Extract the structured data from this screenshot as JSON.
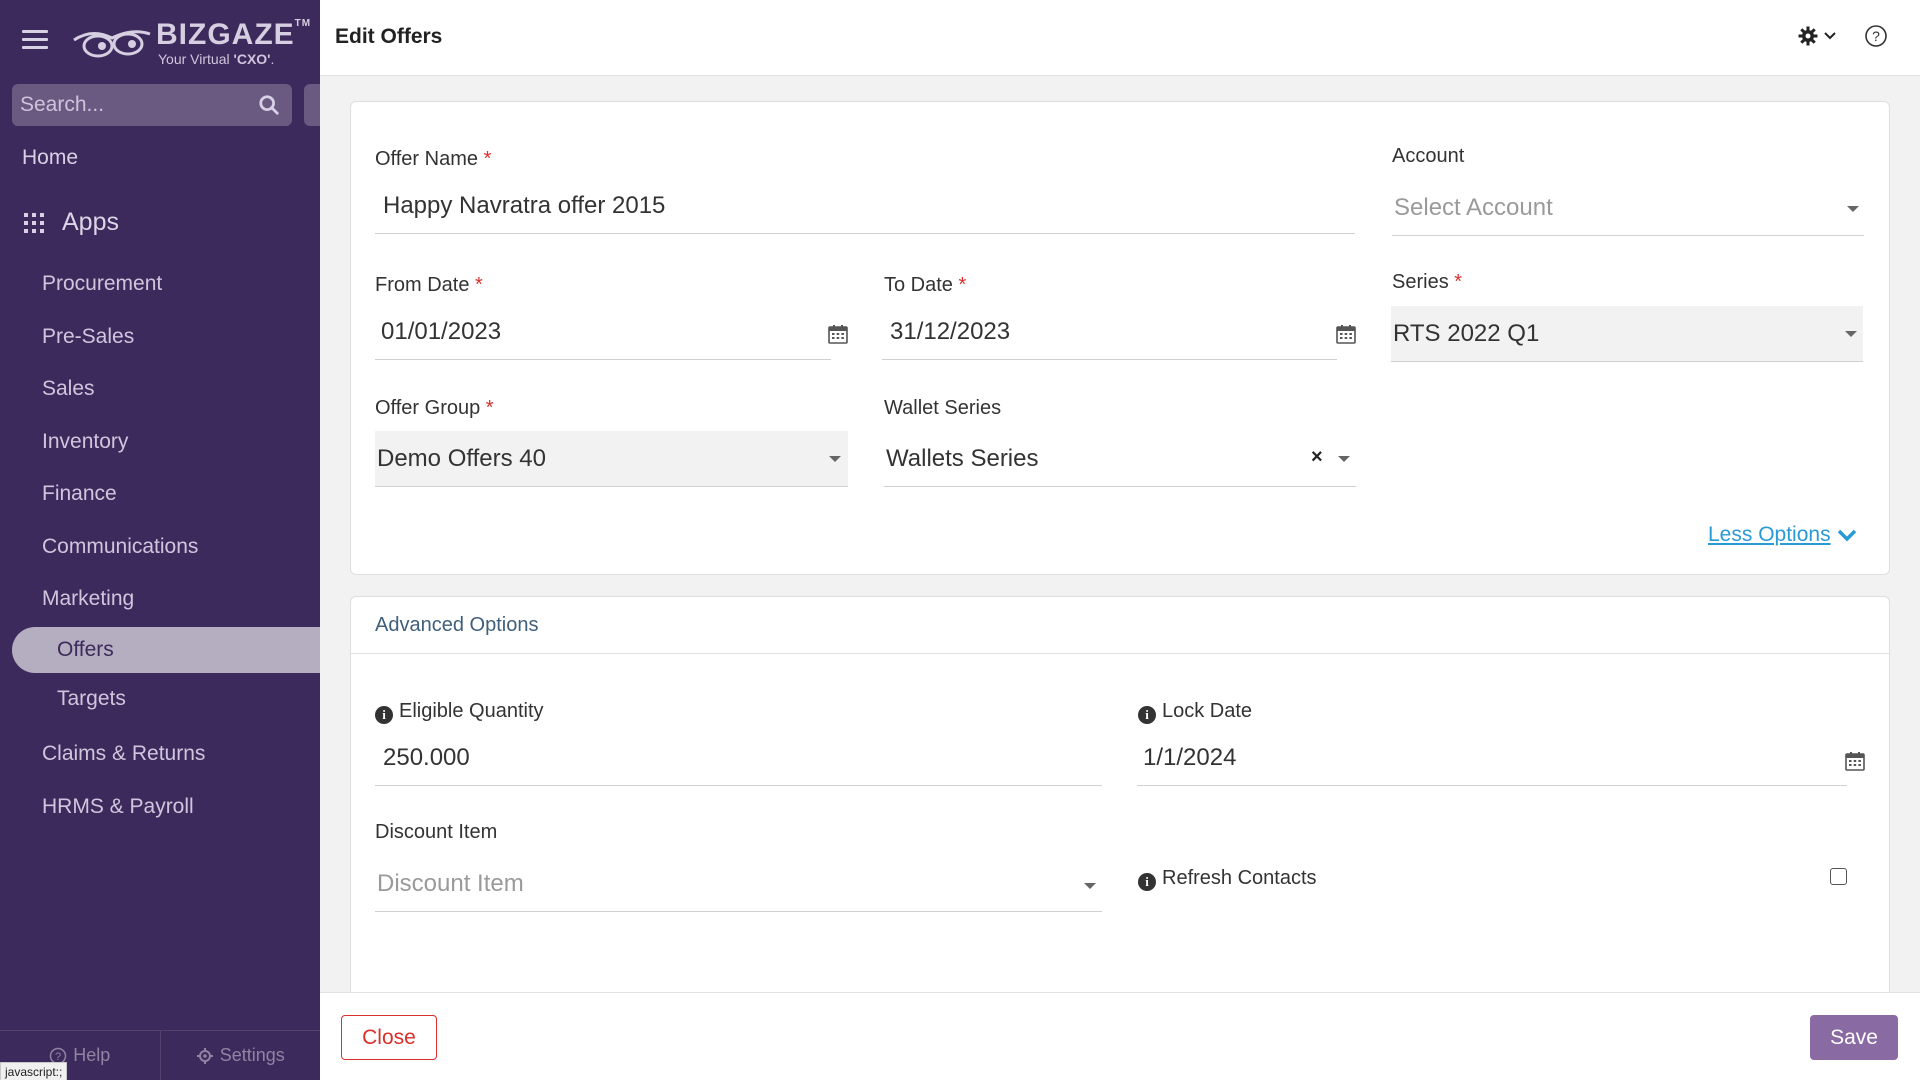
{
  "app": {
    "brand": "BIZGAZE",
    "brand_tm": "TM",
    "tagline_pre": "Your Virtual ",
    "tagline_bold": "'CXO'",
    "tagline_post": "."
  },
  "sidebar": {
    "search_placeholder": "Search...",
    "home": "Home",
    "apps": "Apps",
    "items": [
      "Procurement",
      "Pre-Sales",
      "Sales",
      "Inventory",
      "Finance",
      "Communications",
      "Marketing"
    ],
    "marketing_sub": [
      "Offers",
      "Targets"
    ],
    "items_after": [
      "Claims & Returns",
      "HRMS & Payroll"
    ],
    "help": "Help",
    "settings": "Settings",
    "status_url": "javascript:;"
  },
  "header": {
    "title": "Edit Offers"
  },
  "form": {
    "offer_name": {
      "label": "Offer Name",
      "value": "Happy Navratra offer 2015"
    },
    "account": {
      "label": "Account",
      "placeholder": "Select Account"
    },
    "from_date": {
      "label": "From Date",
      "value": "01/01/2023"
    },
    "to_date": {
      "label": "To Date",
      "value": "31/12/2023"
    },
    "series": {
      "label": "Series",
      "value": "RTS 2022 Q1"
    },
    "offer_group": {
      "label": "Offer Group",
      "value": "Demo Offers 40"
    },
    "wallet_series": {
      "label": "Wallet Series",
      "value": "Wallets Series"
    },
    "required_mark": "*",
    "less_options": "Less Options"
  },
  "advanced": {
    "title": "Advanced Options",
    "eligible_quantity": {
      "label": "Eligible Quantity",
      "value": "250.000"
    },
    "lock_date": {
      "label": "Lock Date",
      "value": "1/1/2024"
    },
    "discount_item": {
      "label": "Discount Item",
      "placeholder": "Discount Item"
    },
    "refresh_contacts": {
      "label": "Refresh Contacts",
      "checked": false
    }
  },
  "footer": {
    "close": "Close",
    "save": "Save"
  },
  "colors": {
    "sidebar": "#3d2a5c",
    "accent": "#8a6aa3",
    "danger": "#d9302b",
    "link": "#2a9ad6"
  }
}
